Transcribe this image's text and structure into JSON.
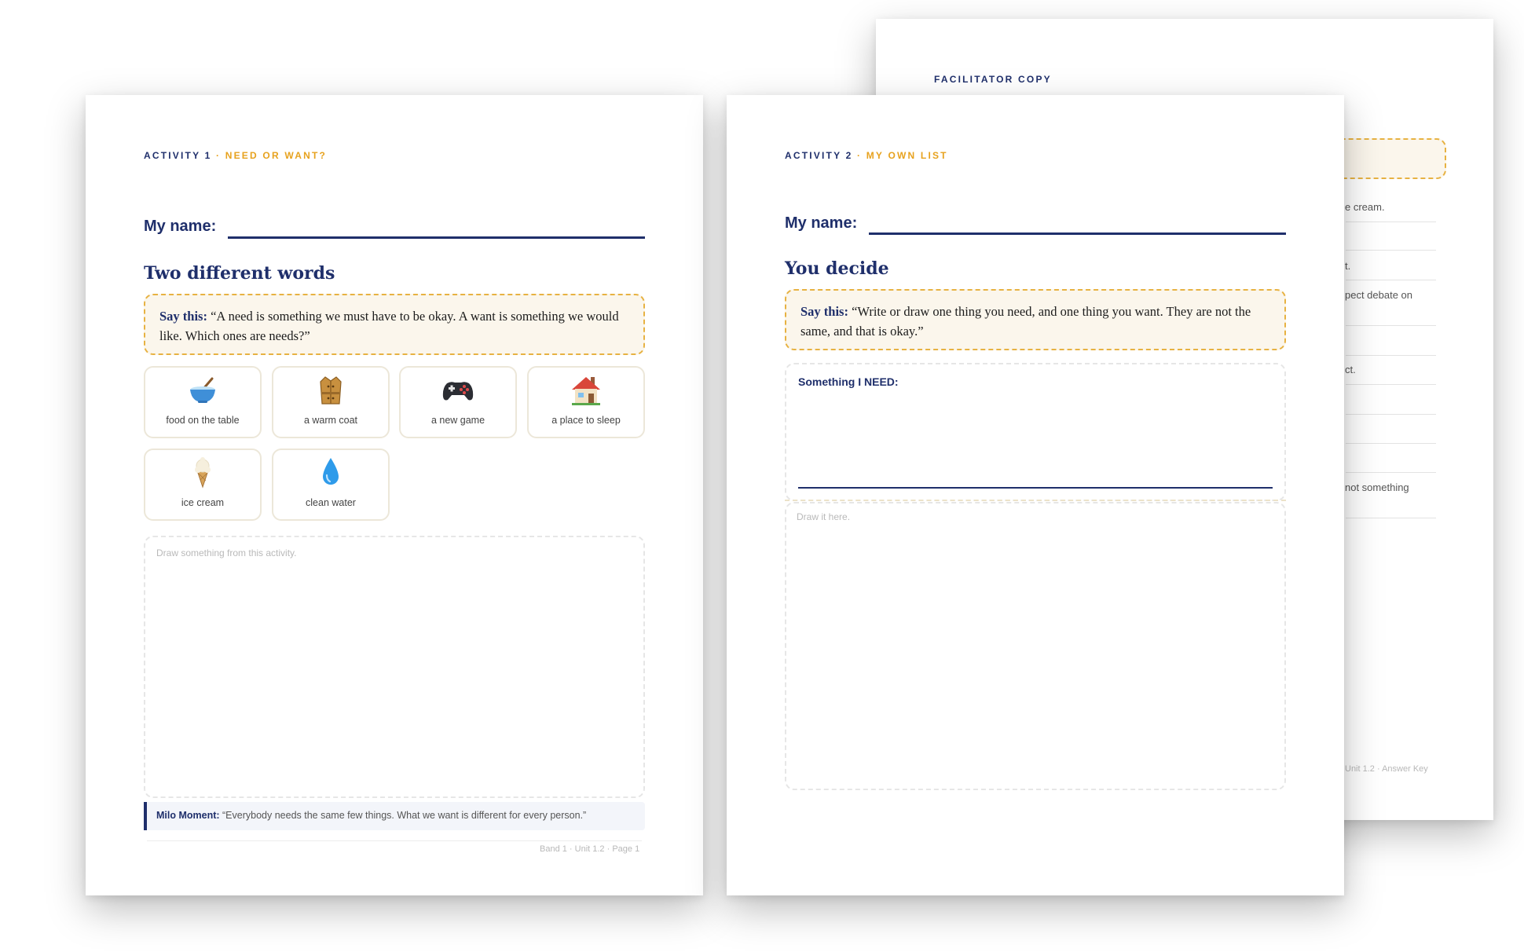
{
  "back_page": {
    "kicker": "FACILITATOR COPY",
    "fragments": [
      "e cream.",
      "t.",
      "pect debate on",
      "ct.",
      "not something"
    ],
    "footer": "Unit 1.2 · Answer Key"
  },
  "page1": {
    "kicker_num": "ACTIVITY 1",
    "kicker_sep": " · ",
    "kicker_title": "NEED OR WANT?",
    "name_label": "My name:",
    "heading": "Two different words",
    "say_label": "Say this:",
    "say_text": " “A need is something we must have to be okay. A want is something we would like. Which ones are needs?”",
    "cards": [
      {
        "icon": "bowl-icon",
        "label": "food on the table"
      },
      {
        "icon": "coat-icon",
        "label": "a warm coat"
      },
      {
        "icon": "game-controller-icon",
        "label": "a new game"
      },
      {
        "icon": "house-icon",
        "label": "a place to sleep"
      },
      {
        "icon": "ice-cream-icon",
        "label": "ice cream"
      },
      {
        "icon": "water-drop-icon",
        "label": "clean water"
      }
    ],
    "draw_hint": "Draw something from this activity.",
    "milo_label": "Milo Moment:",
    "milo_text": " “Everybody needs the same few things. What we want is different for every person.”",
    "footer": "Band 1 · Unit 1.2 · Page 1"
  },
  "page2": {
    "kicker_num": "ACTIVITY 2",
    "kicker_sep": " · ",
    "kicker_title": "MY OWN LIST",
    "name_label": "My name:",
    "heading": "You decide",
    "say_label": "Say this:",
    "say_text": " “Write or draw one thing you need, and one thing you want. They are not the same, and that is okay.”",
    "need_label": "Something I NEED:",
    "draw_hint": "Draw it here."
  },
  "colors": {
    "navy": "#1f2f6b",
    "gold": "#e7a21e",
    "say_bg": "#fbf6ec",
    "say_border": "#e7b242"
  }
}
